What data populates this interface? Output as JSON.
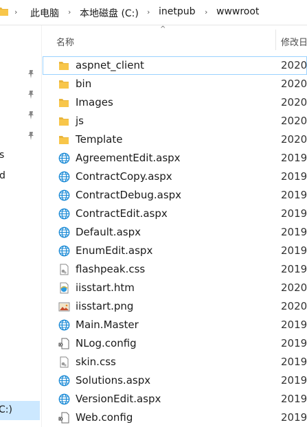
{
  "breadcrumb": [
    "此电脑",
    "本地磁盘 (C:)",
    "inetpub",
    "wwwroot"
  ],
  "columns": {
    "name": "名称",
    "date": "修改日"
  },
  "nav": {
    "fragments": [
      "s",
      "d"
    ],
    "selected_drive": "C:)"
  },
  "colors": {
    "folder": "#f8c64a",
    "web_globe": "#1a8ad6",
    "selection": "#cce8ff",
    "selection_border": "#99d1ff"
  },
  "files": [
    {
      "name": "aspnet_client",
      "date": "2020,",
      "icon": "folder-icon"
    },
    {
      "name": "bin",
      "date": "2020,",
      "icon": "folder-icon"
    },
    {
      "name": "Images",
      "date": "2020,",
      "icon": "folder-icon"
    },
    {
      "name": "js",
      "date": "2020,",
      "icon": "folder-icon"
    },
    {
      "name": "Template",
      "date": "2020,",
      "icon": "folder-icon"
    },
    {
      "name": "AgreementEdit.aspx",
      "date": "2019,",
      "icon": "aspx-globe-icon"
    },
    {
      "name": "ContractCopy.aspx",
      "date": "2019,",
      "icon": "aspx-globe-icon"
    },
    {
      "name": "ContractDebug.aspx",
      "date": "2019,",
      "icon": "aspx-globe-icon"
    },
    {
      "name": "ContractEdit.aspx",
      "date": "2019,",
      "icon": "aspx-globe-icon"
    },
    {
      "name": "Default.aspx",
      "date": "2019,",
      "icon": "aspx-globe-icon"
    },
    {
      "name": "EnumEdit.aspx",
      "date": "2019,",
      "icon": "aspx-globe-icon"
    },
    {
      "name": "flashpeak.css",
      "date": "2019,",
      "icon": "css-file-icon"
    },
    {
      "name": "iisstart.htm",
      "date": "2020,",
      "icon": "htm-file-icon"
    },
    {
      "name": "iisstart.png",
      "date": "2020,",
      "icon": "png-file-icon"
    },
    {
      "name": "Main.Master",
      "date": "2019,",
      "icon": "aspx-globe-icon"
    },
    {
      "name": "NLog.config",
      "date": "2019,",
      "icon": "config-file-icon"
    },
    {
      "name": "skin.css",
      "date": "2019,",
      "icon": "css-file-icon"
    },
    {
      "name": "Solutions.aspx",
      "date": "2019,",
      "icon": "aspx-globe-icon"
    },
    {
      "name": "VersionEdit.aspx",
      "date": "2019,",
      "icon": "aspx-globe-icon"
    },
    {
      "name": "Web.config",
      "date": "2019,",
      "icon": "config-file-icon"
    }
  ]
}
